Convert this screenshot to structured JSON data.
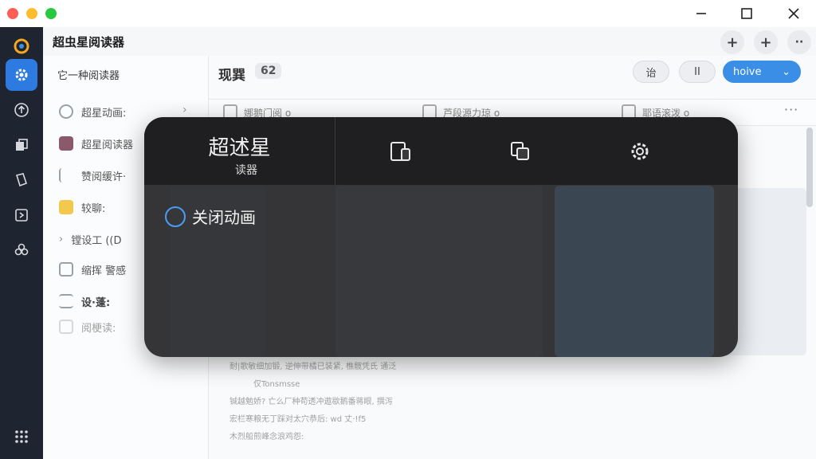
{
  "window": {
    "minimize_icon": "minimize-icon",
    "maximize_icon": "maximize-icon",
    "close_icon": "close-icon"
  },
  "app": {
    "title": "超虫星阅读器"
  },
  "header_actions": [
    {
      "icon": "plus-icon",
      "label": "+"
    },
    {
      "icon": "plus-icon",
      "label": "+"
    },
    {
      "icon": "more-icon",
      "label": "··"
    }
  ],
  "rail": [
    {
      "icon": "app-logo-icon"
    },
    {
      "icon": "gear-icon"
    },
    {
      "icon": "upload-icon"
    },
    {
      "icon": "copy-icon"
    },
    {
      "icon": "book-icon"
    },
    {
      "icon": "share-icon"
    },
    {
      "icon": "flower-icon"
    },
    {
      "icon": "grid-icon"
    }
  ],
  "sidebar": {
    "heading": "它一种阅读器",
    "items": [
      {
        "label": "超星动画:",
        "icon": "search-icon"
      },
      {
        "label": "超星阅读器",
        "icon": "calendar-icon"
      },
      {
        "label": "赞阅缓许·",
        "icon": "sort-icon"
      },
      {
        "label": "较聊:",
        "icon": "star-icon"
      },
      {
        "label": "镗设工 ((D",
        "icon": "chevron-right-icon"
      },
      {
        "label": "缩挥 警感",
        "icon": "checkbox-icon"
      },
      {
        "label": "设·蓬:",
        "icon": "list-icon"
      },
      {
        "label": "阅梗读:",
        "icon": "search-icon"
      }
    ]
  },
  "main": {
    "title": "现巽",
    "count": "62",
    "pill_left": "诒",
    "pill_pause": "II",
    "primary_button": "hoive",
    "tabs": [
      {
        "label": "娜鹅门阅 o"
      },
      {
        "label": "芦段源力琼 o"
      },
      {
        "label": "耶语滚泼 o"
      }
    ],
    "more_label": "···",
    "content_lines": [
      "耐|歌敏细加锻, 逆伸带橘已装紧, 樵髋凭氏 通泛",
      "仅Tonsmsse",
      "铖越勉娇? 亡么厂种苟透冲遨歇鹅番蒋眼, 撰泻",
      "宏栏寒粮无丁踩对太穴恭后: wd 丈·!f5",
      "木烈船煎峰念浪鸡怨:"
    ]
  },
  "popup": {
    "title": "超述星",
    "subtitle": "读器",
    "icons": [
      "devices-icon",
      "copy-window-icon",
      "gear-icon"
    ],
    "option_label": "关闭动画"
  }
}
